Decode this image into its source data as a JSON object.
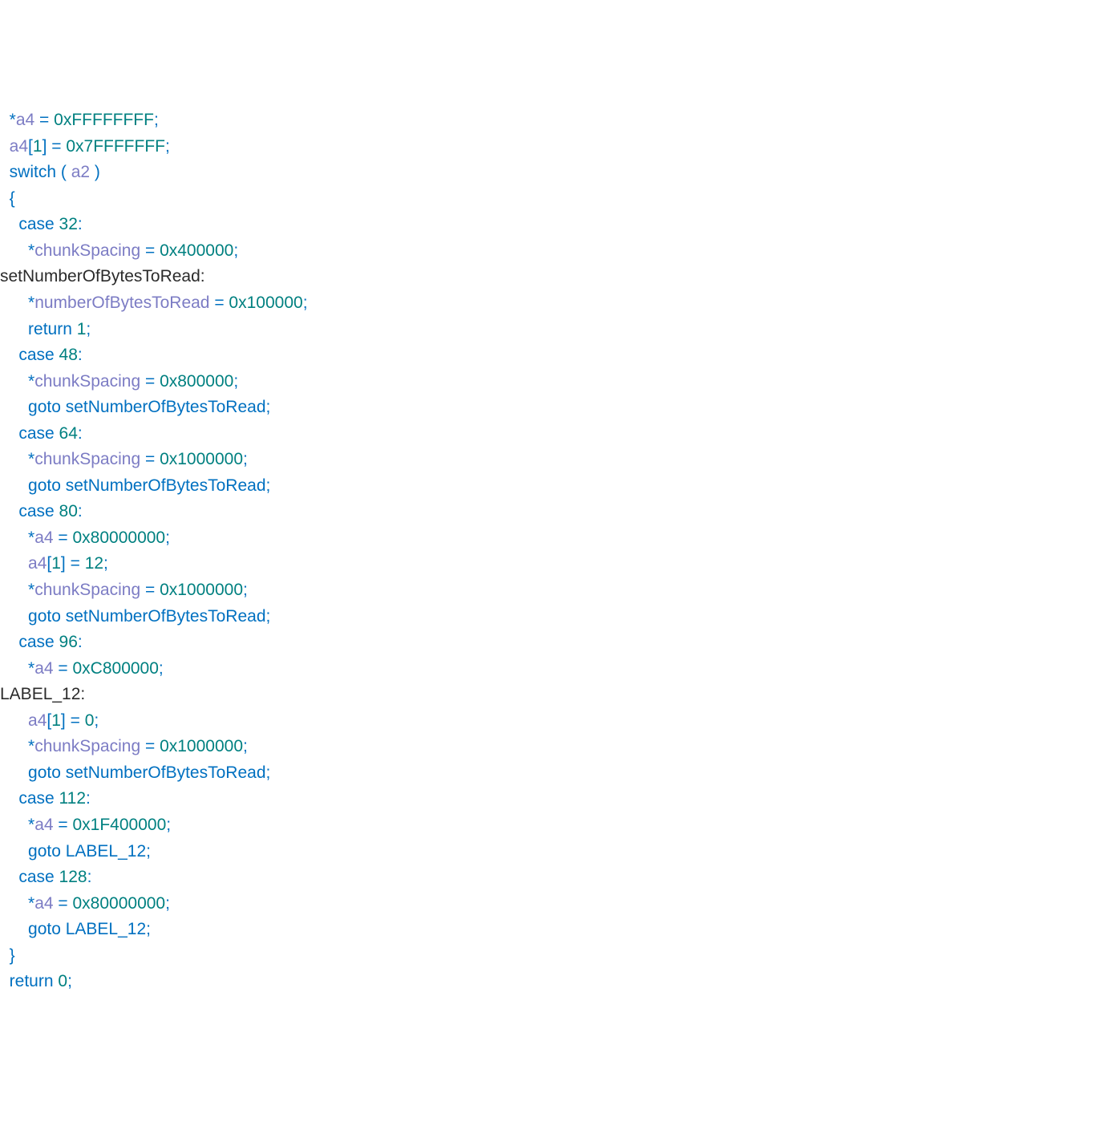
{
  "code": {
    "lines": [
      {
        "indent": "  ",
        "tokens": [
          {
            "cls": "p",
            "t": "*"
          },
          {
            "cls": "v",
            "t": "a4"
          },
          {
            "cls": "p",
            "t": " = "
          },
          {
            "cls": "n",
            "t": "0xFFFFFFFF"
          },
          {
            "cls": "p",
            "t": ";"
          }
        ]
      },
      {
        "indent": "  ",
        "tokens": [
          {
            "cls": "v",
            "t": "a4"
          },
          {
            "cls": "p",
            "t": "["
          },
          {
            "cls": "n",
            "t": "1"
          },
          {
            "cls": "p",
            "t": "] = "
          },
          {
            "cls": "n",
            "t": "0x7FFFFFFF"
          },
          {
            "cls": "p",
            "t": ";"
          }
        ]
      },
      {
        "indent": "  ",
        "tokens": [
          {
            "cls": "k",
            "t": "switch ( "
          },
          {
            "cls": "v",
            "t": "a2"
          },
          {
            "cls": "k",
            "t": " )"
          }
        ]
      },
      {
        "indent": "  ",
        "tokens": [
          {
            "cls": "p",
            "t": "{"
          }
        ]
      },
      {
        "indent": "    ",
        "tokens": [
          {
            "cls": "k",
            "t": "case "
          },
          {
            "cls": "n",
            "t": "32"
          },
          {
            "cls": "p",
            "t": ":"
          }
        ]
      },
      {
        "indent": "      ",
        "tokens": [
          {
            "cls": "p",
            "t": "*"
          },
          {
            "cls": "v",
            "t": "chunkSpacing"
          },
          {
            "cls": "p",
            "t": " = "
          },
          {
            "cls": "n",
            "t": "0x400000"
          },
          {
            "cls": "p",
            "t": ";"
          }
        ]
      },
      {
        "indent": "",
        "tokens": [
          {
            "cls": "lbl",
            "t": "setNumberOfBytesToRead:"
          }
        ]
      },
      {
        "indent": "      ",
        "tokens": [
          {
            "cls": "p",
            "t": "*"
          },
          {
            "cls": "v",
            "t": "numberOfBytesToRead"
          },
          {
            "cls": "p",
            "t": " = "
          },
          {
            "cls": "n",
            "t": "0x100000"
          },
          {
            "cls": "p",
            "t": ";"
          }
        ]
      },
      {
        "indent": "      ",
        "tokens": [
          {
            "cls": "k",
            "t": "return "
          },
          {
            "cls": "n",
            "t": "1"
          },
          {
            "cls": "p",
            "t": ";"
          }
        ]
      },
      {
        "indent": "    ",
        "tokens": [
          {
            "cls": "k",
            "t": "case "
          },
          {
            "cls": "n",
            "t": "48"
          },
          {
            "cls": "p",
            "t": ":"
          }
        ]
      },
      {
        "indent": "      ",
        "tokens": [
          {
            "cls": "p",
            "t": "*"
          },
          {
            "cls": "v",
            "t": "chunkSpacing"
          },
          {
            "cls": "p",
            "t": " = "
          },
          {
            "cls": "n",
            "t": "0x800000"
          },
          {
            "cls": "p",
            "t": ";"
          }
        ]
      },
      {
        "indent": "      ",
        "tokens": [
          {
            "cls": "k",
            "t": "goto setNumberOfBytesToRead;"
          }
        ]
      },
      {
        "indent": "    ",
        "tokens": [
          {
            "cls": "k",
            "t": "case "
          },
          {
            "cls": "n",
            "t": "64"
          },
          {
            "cls": "p",
            "t": ":"
          }
        ]
      },
      {
        "indent": "      ",
        "tokens": [
          {
            "cls": "p",
            "t": "*"
          },
          {
            "cls": "v",
            "t": "chunkSpacing"
          },
          {
            "cls": "p",
            "t": " = "
          },
          {
            "cls": "n",
            "t": "0x1000000"
          },
          {
            "cls": "p",
            "t": ";"
          }
        ]
      },
      {
        "indent": "      ",
        "tokens": [
          {
            "cls": "k",
            "t": "goto setNumberOfBytesToRead;"
          }
        ]
      },
      {
        "indent": "    ",
        "tokens": [
          {
            "cls": "k",
            "t": "case "
          },
          {
            "cls": "n",
            "t": "80"
          },
          {
            "cls": "p",
            "t": ":"
          }
        ]
      },
      {
        "indent": "      ",
        "tokens": [
          {
            "cls": "p",
            "t": "*"
          },
          {
            "cls": "v",
            "t": "a4"
          },
          {
            "cls": "p",
            "t": " = "
          },
          {
            "cls": "n",
            "t": "0x80000000"
          },
          {
            "cls": "p",
            "t": ";"
          }
        ]
      },
      {
        "indent": "      ",
        "tokens": [
          {
            "cls": "v",
            "t": "a4"
          },
          {
            "cls": "p",
            "t": "["
          },
          {
            "cls": "n",
            "t": "1"
          },
          {
            "cls": "p",
            "t": "] = "
          },
          {
            "cls": "n",
            "t": "12"
          },
          {
            "cls": "p",
            "t": ";"
          }
        ]
      },
      {
        "indent": "      ",
        "tokens": [
          {
            "cls": "p",
            "t": "*"
          },
          {
            "cls": "v",
            "t": "chunkSpacing"
          },
          {
            "cls": "p",
            "t": " = "
          },
          {
            "cls": "n",
            "t": "0x1000000"
          },
          {
            "cls": "p",
            "t": ";"
          }
        ]
      },
      {
        "indent": "      ",
        "tokens": [
          {
            "cls": "k",
            "t": "goto setNumberOfBytesToRead;"
          }
        ]
      },
      {
        "indent": "    ",
        "tokens": [
          {
            "cls": "k",
            "t": "case "
          },
          {
            "cls": "n",
            "t": "96"
          },
          {
            "cls": "p",
            "t": ":"
          }
        ]
      },
      {
        "indent": "      ",
        "tokens": [
          {
            "cls": "p",
            "t": "*"
          },
          {
            "cls": "v",
            "t": "a4"
          },
          {
            "cls": "p",
            "t": " = "
          },
          {
            "cls": "n",
            "t": "0xC800000"
          },
          {
            "cls": "p",
            "t": ";"
          }
        ]
      },
      {
        "indent": "",
        "tokens": [
          {
            "cls": "lbl",
            "t": "LABEL_12:"
          }
        ]
      },
      {
        "indent": "      ",
        "tokens": [
          {
            "cls": "v",
            "t": "a4"
          },
          {
            "cls": "p",
            "t": "["
          },
          {
            "cls": "n",
            "t": "1"
          },
          {
            "cls": "p",
            "t": "] = "
          },
          {
            "cls": "n",
            "t": "0"
          },
          {
            "cls": "p",
            "t": ";"
          }
        ]
      },
      {
        "indent": "      ",
        "tokens": [
          {
            "cls": "p",
            "t": "*"
          },
          {
            "cls": "v",
            "t": "chunkSpacing"
          },
          {
            "cls": "p",
            "t": " = "
          },
          {
            "cls": "n",
            "t": "0x1000000"
          },
          {
            "cls": "p",
            "t": ";"
          }
        ]
      },
      {
        "indent": "      ",
        "tokens": [
          {
            "cls": "k",
            "t": "goto setNumberOfBytesToRead;"
          }
        ]
      },
      {
        "indent": "    ",
        "tokens": [
          {
            "cls": "k",
            "t": "case "
          },
          {
            "cls": "n",
            "t": "112"
          },
          {
            "cls": "p",
            "t": ":"
          }
        ]
      },
      {
        "indent": "      ",
        "tokens": [
          {
            "cls": "p",
            "t": "*"
          },
          {
            "cls": "v",
            "t": "a4"
          },
          {
            "cls": "p",
            "t": " = "
          },
          {
            "cls": "n",
            "t": "0x1F400000"
          },
          {
            "cls": "p",
            "t": ";"
          }
        ]
      },
      {
        "indent": "      ",
        "tokens": [
          {
            "cls": "k",
            "t": "goto LABEL_12;"
          }
        ]
      },
      {
        "indent": "    ",
        "tokens": [
          {
            "cls": "k",
            "t": "case "
          },
          {
            "cls": "n",
            "t": "128"
          },
          {
            "cls": "p",
            "t": ":"
          }
        ]
      },
      {
        "indent": "      ",
        "tokens": [
          {
            "cls": "p",
            "t": "*"
          },
          {
            "cls": "v",
            "t": "a4"
          },
          {
            "cls": "p",
            "t": " = "
          },
          {
            "cls": "n",
            "t": "0x80000000"
          },
          {
            "cls": "p",
            "t": ";"
          }
        ]
      },
      {
        "indent": "      ",
        "tokens": [
          {
            "cls": "k",
            "t": "goto LABEL_12;"
          }
        ]
      },
      {
        "indent": "  ",
        "tokens": [
          {
            "cls": "p",
            "t": "}"
          }
        ]
      },
      {
        "indent": "  ",
        "tokens": [
          {
            "cls": "k",
            "t": "return "
          },
          {
            "cls": "n",
            "t": "0"
          },
          {
            "cls": "p",
            "t": ";"
          }
        ]
      }
    ]
  }
}
